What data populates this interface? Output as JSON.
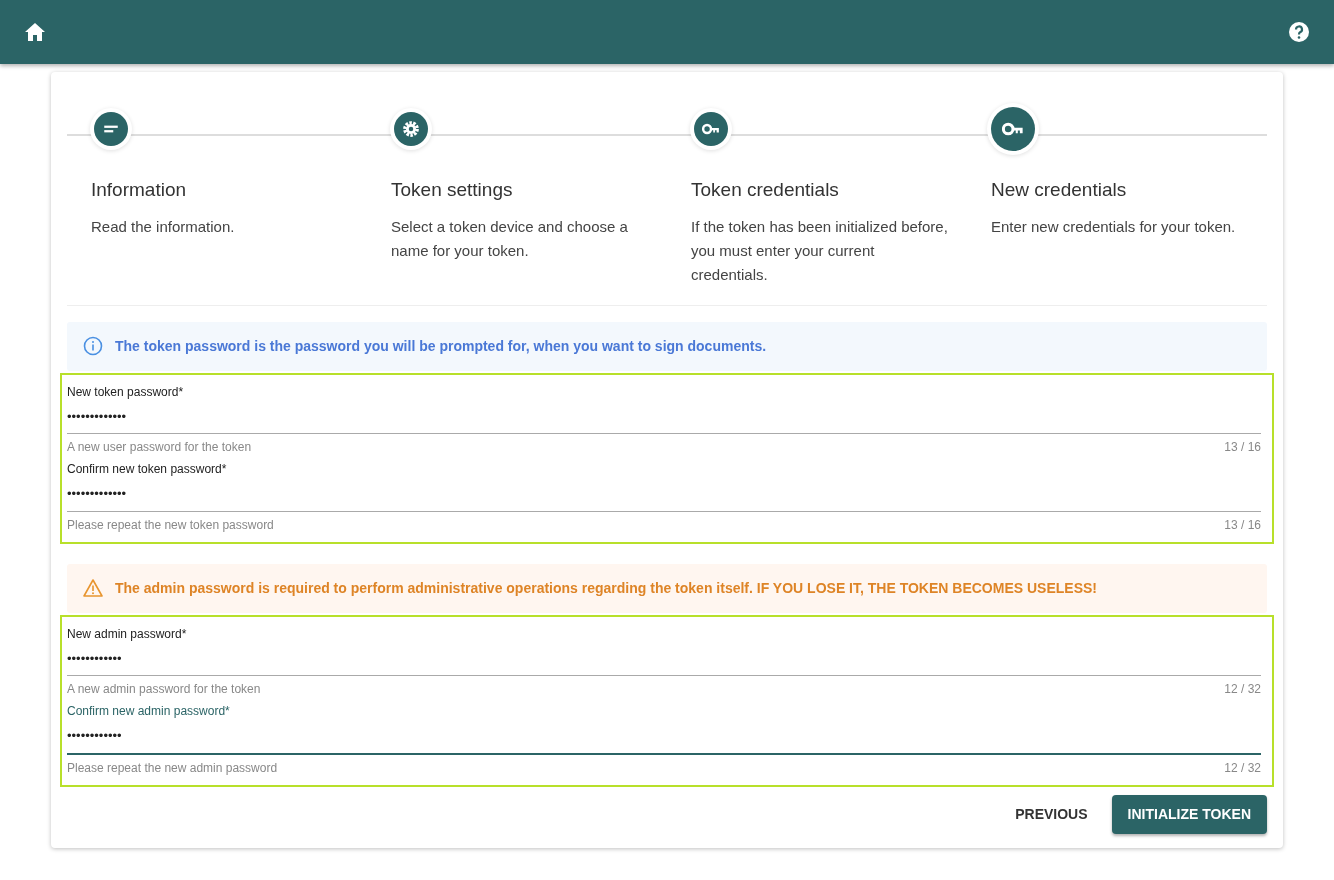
{
  "steps": [
    {
      "kind": "info",
      "title": "Information",
      "description": "Read the information.",
      "selected": false
    },
    {
      "kind": "gear",
      "title": "Token settings",
      "description": "Select a token device and choose a name for your token.",
      "selected": false
    },
    {
      "kind": "key",
      "title": "Token credentials",
      "description": "If the token has been initialized before, you must enter your current credentials.",
      "selected": false
    },
    {
      "kind": "key",
      "title": "New credentials",
      "description": "Enter new credentials for your token.",
      "selected": true
    }
  ],
  "sections": [
    {
      "alert": {
        "kind": "info",
        "text": "The token password is the password you will be prompted for, when you want to sign documents."
      },
      "fields": [
        {
          "label": "New token password*",
          "value": "•••••••••••••",
          "hint": "A new user password for the token",
          "counter": "13 / 16",
          "focused": false
        },
        {
          "label": "Confirm new token password*",
          "value": "•••••••••••••",
          "hint": "Please repeat the new token password",
          "counter": "13 / 16",
          "focused": false
        }
      ]
    },
    {
      "alert": {
        "kind": "warning",
        "text": "The admin password is required to perform administrative operations regarding the token itself. IF YOU LOSE IT, THE TOKEN BECOMES USELESS!"
      },
      "fields": [
        {
          "label": "New admin password*",
          "value": "••••••••••••",
          "hint": "A new admin password for the token",
          "counter": "12 / 32",
          "focused": false
        },
        {
          "label": "Confirm new admin password*",
          "value": "••••••••••••",
          "hint": "Please repeat the new admin password",
          "counter": "12 / 32",
          "focused": true
        }
      ]
    }
  ],
  "buttons": [
    {
      "kind": "text",
      "label": "PREVIOUS"
    },
    {
      "kind": "primary",
      "label": "INITIALIZE TOKEN"
    }
  ]
}
